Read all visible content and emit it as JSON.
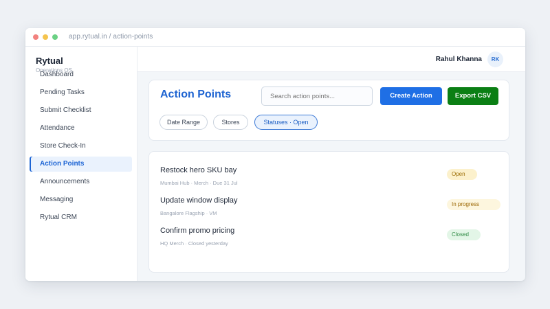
{
  "browser": {
    "url": "app.rytual.in / action-points"
  },
  "sidebar": {
    "brand_name": "Rytual",
    "brand_sub": "Operations OS",
    "items": [
      {
        "label": "Dashboard",
        "active": false
      },
      {
        "label": "Pending Tasks",
        "active": false
      },
      {
        "label": "Submit Checklist",
        "active": false
      },
      {
        "label": "Attendance",
        "active": false
      },
      {
        "label": "Store Check-In",
        "active": false
      },
      {
        "label": "Action Points",
        "active": true
      },
      {
        "label": "Announcements",
        "active": false
      },
      {
        "label": "Messaging",
        "active": false
      },
      {
        "label": "Rytual CRM",
        "active": false
      }
    ]
  },
  "topbar": {
    "user_name": "Rahul Khanna",
    "avatar_initials": "RK"
  },
  "header": {
    "title": "Action Points",
    "search_placeholder": "Search action points...",
    "create_label": "Create Action",
    "export_label": "Export CSV"
  },
  "filters": {
    "date_range": "Date Range",
    "stores": "Stores",
    "statuses": "Statuses · Open"
  },
  "action_points": [
    {
      "title": "Restock hero SKU bay",
      "meta": "Mumbai Hub · Merch · Due 31 Jul",
      "status": "Open"
    },
    {
      "title": "Update window display",
      "meta": "Bangalore Flagship · VM",
      "status": "In progress"
    },
    {
      "title": "Confirm promo pricing",
      "meta": "HQ Merch · Closed yesterday",
      "status": "Closed"
    }
  ],
  "colors": {
    "accent": "#1f6fe5",
    "export_green": "#0b7f14",
    "open_badge": "#fcf1cc",
    "progress_badge": "#fdf6de",
    "closed_badge": "#e3f6e7"
  }
}
